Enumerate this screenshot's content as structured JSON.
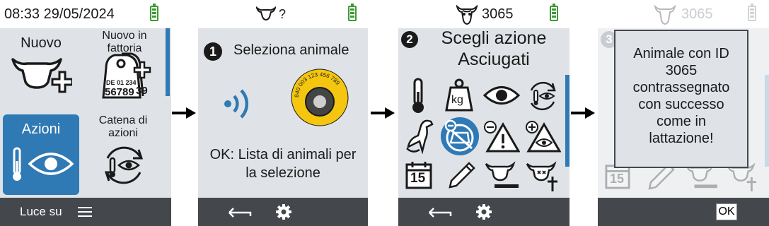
{
  "screen1": {
    "time_date": "08:33 29/05/2024",
    "tiles": {
      "nuovo": "Nuovo",
      "nuovo_in_fattoria": "Nuovo in fattoria",
      "tag_line1": "DE 01 234",
      "tag_line2": "56789",
      "tag_side": "39",
      "azioni": "Azioni",
      "catena_di_azioni": "Catena di azioni"
    },
    "bottom": {
      "light_label": "Luce su",
      "menu_icon": "menu-icon"
    }
  },
  "screen2": {
    "header_suffix": "?",
    "step_number": "1",
    "title": "Seleziona animale",
    "tag_number": "840 003 123 456 789",
    "ok_hint": "OK: Lista di animali per la selezione"
  },
  "screen3": {
    "animal_id": "3065",
    "step_number": "2",
    "title": "Scegli azione",
    "subtitle": "Asciugati",
    "weight_unit": "kg",
    "calendar_day": "15"
  },
  "screen4": {
    "animal_id": "3065",
    "step_number": "3",
    "message": "Animale con ID 3065 contrassegnato con successo come in lattazione!",
    "ok_label": "OK",
    "calendar_day": "15"
  },
  "colors": {
    "accent_blue": "#2f79b5",
    "battery_green": "#3c9a34",
    "bar_dark": "#44474c",
    "panel_grey": "#dfe3e7"
  }
}
